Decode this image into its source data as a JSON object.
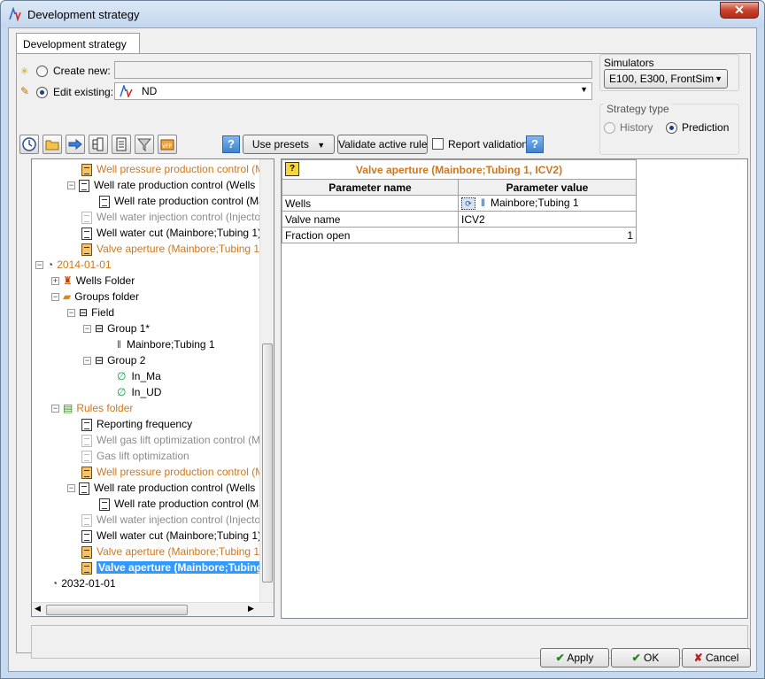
{
  "window": {
    "title": "Development strategy",
    "close_label": "✕"
  },
  "tab": {
    "label": "Development strategy"
  },
  "mode": {
    "create_label": "Create new:",
    "edit_label": "Edit existing:",
    "edit_value": "ND"
  },
  "simulators": {
    "label": "Simulators",
    "value": "E100,  E300,  FrontSim"
  },
  "strategy_type": {
    "label": "Strategy type",
    "history": "History",
    "prediction": "Prediction"
  },
  "toolbar": {
    "help_label": "?",
    "use_presets": "Use presets",
    "validate": "Validate active rule",
    "report_validation": "Report validation"
  },
  "tree": {
    "rows": [
      {
        "label": "Well pressure production control (M"
      },
      {
        "label": "Well rate production control (Wells"
      },
      {
        "label": "Well rate production control (Ma"
      },
      {
        "label": "Well water injection control (Injector"
      },
      {
        "label": "Well water cut (Mainbore;Tubing 1)"
      },
      {
        "label": "Valve aperture (Mainbore;Tubing 1,"
      },
      {
        "label": "2014-01-01"
      },
      {
        "label": "Wells Folder"
      },
      {
        "label": "Groups folder"
      },
      {
        "label": "Field"
      },
      {
        "label": "Group 1*"
      },
      {
        "label": "Mainbore;Tubing 1"
      },
      {
        "label": "Group 2"
      },
      {
        "label": "In_Ma"
      },
      {
        "label": "In_UD"
      },
      {
        "label": "Rules folder"
      },
      {
        "label": "Reporting frequency"
      },
      {
        "label": "Well gas lift optimization control (M"
      },
      {
        "label": "Gas lift optimization"
      },
      {
        "label": "Well pressure production control (M"
      },
      {
        "label": "Well rate production control (Wells"
      },
      {
        "label": "Well rate production control (Ma"
      },
      {
        "label": "Well water injection control (Injector"
      },
      {
        "label": "Well water cut (Mainbore;Tubing 1)"
      },
      {
        "label": "Valve aperture (Mainbore;Tubing 1,"
      },
      {
        "label": "Valve aperture (Mainbore;Tubing"
      },
      {
        "label": "2032-01-01"
      }
    ]
  },
  "rule": {
    "title": "Valve aperture (Mainbore;Tubing 1, ICV2)",
    "col_name": "Parameter name",
    "col_value": "Parameter value",
    "rows": [
      {
        "name": "Wells",
        "value": "Mainbore;Tubing 1"
      },
      {
        "name": "Valve name",
        "value": "ICV2"
      },
      {
        "name": "Fraction open",
        "value": "1"
      }
    ]
  },
  "footer": {
    "apply": "Apply",
    "ok": "OK",
    "cancel": "Cancel"
  }
}
